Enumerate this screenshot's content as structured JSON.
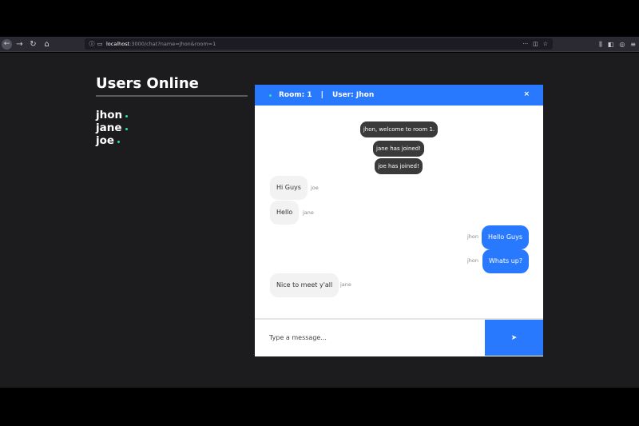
{
  "browser": {
    "back_icon": "arrow-left-icon",
    "forward_icon": "arrow-right-icon",
    "reload_icon": "reload-icon",
    "home_icon": "home-icon",
    "url_host": "localhost",
    "url_rest": ":3000/chat?name=Jhon&room=1"
  },
  "sidebar": {
    "title": "Users Online",
    "users": [
      "jhon",
      "jane",
      "joe"
    ],
    "online_color": "#2ee59d"
  },
  "chat": {
    "header": {
      "room_label": "Room: 1",
      "separator": "|",
      "user_label": "User: Jhon",
      "close": "×"
    },
    "messages": [
      {
        "type": "admin",
        "text": "jhon, welcome to room 1."
      },
      {
        "type": "admin",
        "text": "jane has joined!"
      },
      {
        "type": "admin",
        "text": "joe has joined!"
      },
      {
        "type": "in",
        "text": "Hi Guys",
        "sender": "joe"
      },
      {
        "type": "in",
        "text": "Hello",
        "sender": "jane"
      },
      {
        "type": "out",
        "text": "Hello Guys",
        "sender": "jhon"
      },
      {
        "type": "out",
        "text": "Whats up?",
        "sender": "jhon"
      },
      {
        "type": "in",
        "text": "Nice to meet y'all",
        "sender": "jane"
      }
    ],
    "input_placeholder": "Type a message...",
    "send_icon": "send-icon"
  },
  "colors": {
    "accent": "#2979ff",
    "admin_bubble": "#3a3a3a",
    "in_bubble": "#f2f2f2",
    "page_background": "#1c1c1e"
  }
}
